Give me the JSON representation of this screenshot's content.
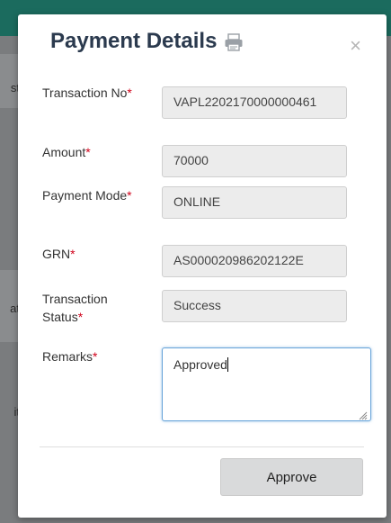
{
  "modal": {
    "title": "Payment Details",
    "close_label": "×"
  },
  "fields": [
    {
      "label": "Transaction No",
      "required_mark": "*",
      "value": "VAPL2202170000000461"
    },
    {
      "label": "Amount",
      "required_mark": "*",
      "value": "70000"
    },
    {
      "label": "Payment Mode",
      "required_mark": "*",
      "value": "ONLINE"
    },
    {
      "label": "GRN",
      "required_mark": "*",
      "value": "AS000020986202122E"
    },
    {
      "label": "Transaction Status",
      "required_mark": "*",
      "value": "Success"
    },
    {
      "label": "Remarks",
      "required_mark": "*",
      "value": "Approved"
    }
  ],
  "footer": {
    "approve_label": "Approve"
  },
  "background": {
    "fragments": [
      "st",
      "at",
      "it",
      "i"
    ]
  },
  "colors": {
    "title": "#2b3a4e",
    "required": "#d0021b",
    "focus_border": "#66a3d9",
    "topbar": "#1b6b5e"
  },
  "icons": {
    "print": "printer-icon",
    "close": "close-icon"
  }
}
